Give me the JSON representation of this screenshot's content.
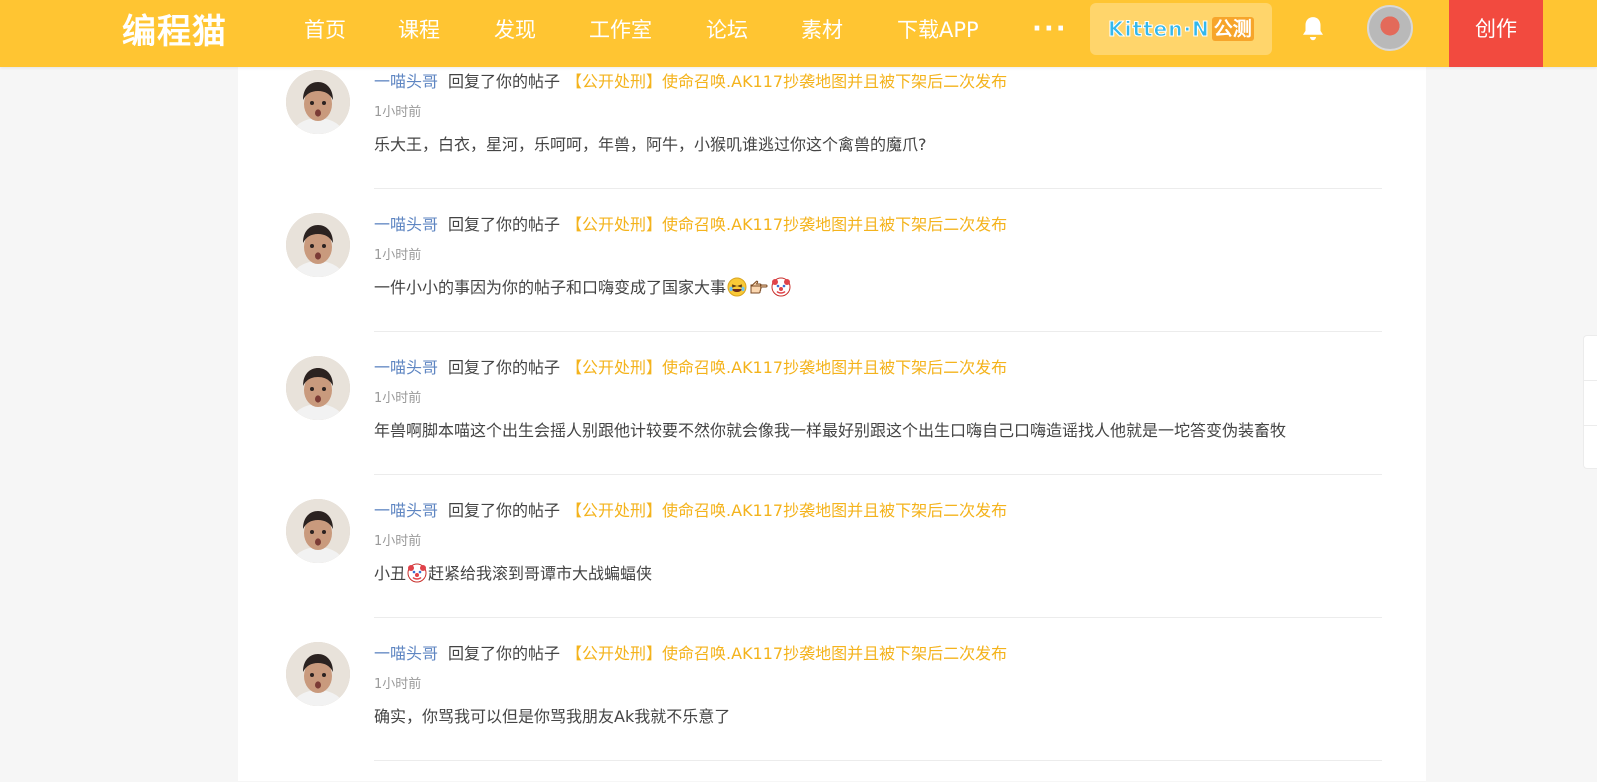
{
  "header": {
    "logo": "编程猫",
    "nav": [
      "首页",
      "课程",
      "发现",
      "工作室",
      "论坛",
      "素材",
      "下载APP"
    ],
    "more": "···",
    "kitten_brand": "Kitten·N",
    "kitten_tag": "公测",
    "create_label": "创作"
  },
  "colors": {
    "header_bg": "#ffc532",
    "create_bg": "#f24a3f",
    "username": "#5f86c2",
    "post_title": "#f4b31c"
  },
  "notifications": [
    {
      "username": "一喵头哥",
      "action": "回复了你的帖子",
      "post_title": "【公开处刑】使命召唤.AK117抄袭地图并且被下架后二次发布",
      "time": "1小时前",
      "content": "乐大王，白衣，星河，乐呵呵，年兽，阿牛，小猴叽谁逃过你这个禽兽的魔爪?"
    },
    {
      "username": "一喵头哥",
      "action": "回复了你的帖子",
      "post_title": "【公开处刑】使命召唤.AK117抄袭地图并且被下架后二次发布",
      "time": "1小时前",
      "content": "一件小小的事因为你的帖子和口嗨变成了国家大事"
    },
    {
      "username": "一喵头哥",
      "action": "回复了你的帖子",
      "post_title": "【公开处刑】使命召唤.AK117抄袭地图并且被下架后二次发布",
      "time": "1小时前",
      "content": "年兽啊脚本喵这个出生会摇人别跟他计较要不然你就会像我一样最好别跟这个出生口嗨自己口嗨造谣找人他就是一坨答变伪装畜牧"
    },
    {
      "username": "一喵头哥",
      "action": "回复了你的帖子",
      "post_title": "【公开处刑】使命召唤.AK117抄袭地图并且被下架后二次发布",
      "time": "1小时前",
      "content_a": "小丑",
      "content_b": "赶紧给我滚到哥谭市大战蝙蝠侠"
    },
    {
      "username": "一喵头哥",
      "action": "回复了你的帖子",
      "post_title": "【公开处刑】使命召唤.AK117抄袭地图并且被下架后二次发布",
      "time": "1小时前",
      "content": "确实，你骂我可以但是你骂我朋友Ak我就不乐意了"
    }
  ]
}
